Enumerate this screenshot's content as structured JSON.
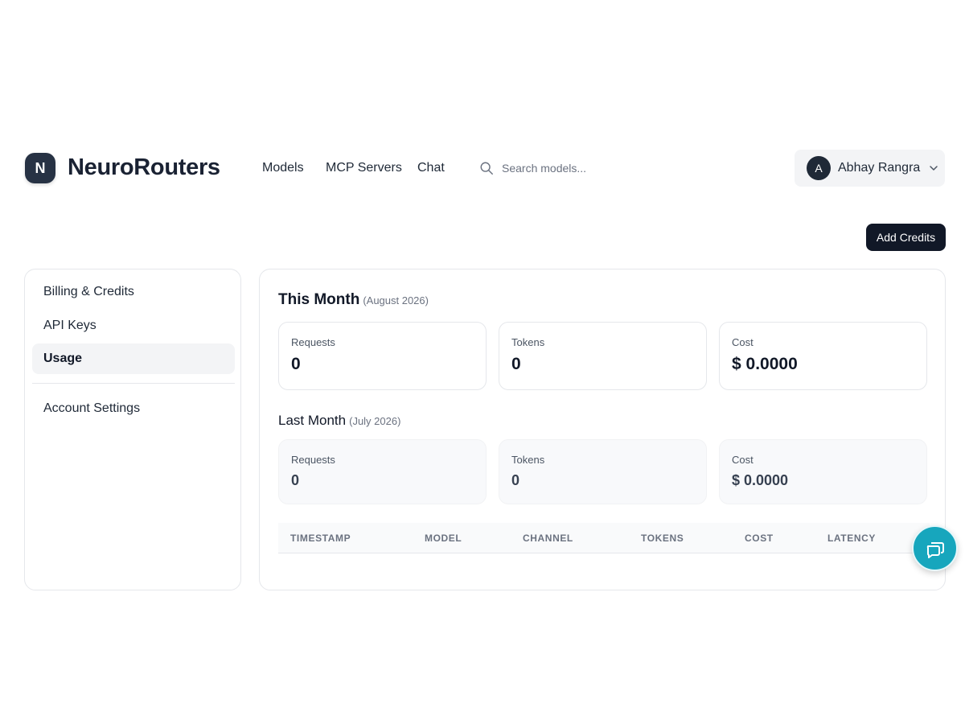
{
  "brand": {
    "logo_letter": "N",
    "name": "NeuroRouters"
  },
  "nav": {
    "items": [
      "Models",
      "MCP Servers",
      "Chat"
    ]
  },
  "search": {
    "placeholder": "Search models...",
    "icon": "search-icon"
  },
  "user": {
    "initial": "A",
    "name": "Abhay Rangra"
  },
  "actions": {
    "add_credits": "Add Credits"
  },
  "sidebar": {
    "items": [
      {
        "label": "Billing & Credits",
        "active": false
      },
      {
        "label": "API Keys",
        "active": false
      },
      {
        "label": "Usage",
        "active": true
      }
    ],
    "secondary": [
      {
        "label": "Account Settings"
      }
    ]
  },
  "this_month": {
    "title": "This Month",
    "period": "(August 2026)",
    "cards": [
      {
        "label": "Requests",
        "value": "0"
      },
      {
        "label": "Tokens",
        "value": "0"
      },
      {
        "label": "Cost",
        "value": "$ 0.0000"
      }
    ]
  },
  "last_month": {
    "title": "Last Month",
    "period": "(July 2026)",
    "cards": [
      {
        "label": "Requests",
        "value": "0"
      },
      {
        "label": "Tokens",
        "value": "0"
      },
      {
        "label": "Cost",
        "value": "$ 0.0000"
      }
    ]
  },
  "table": {
    "columns": [
      "TIMESTAMP",
      "MODEL",
      "CHANNEL",
      "TOKENS",
      "COST",
      "LATENCY"
    ],
    "rows": []
  },
  "colors": {
    "brand_dark": "#273244",
    "button_dark": "#111827",
    "chat_fab": "#17a6bd"
  }
}
